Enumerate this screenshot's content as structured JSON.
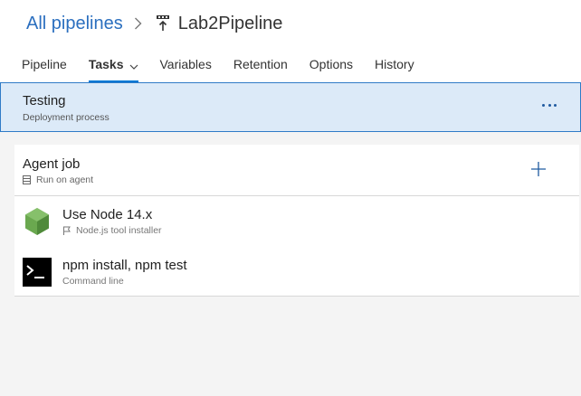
{
  "breadcrumb": {
    "root": "All pipelines",
    "separator_icon": "chevron-right-icon",
    "pipeline_icon": "release-pipeline-icon",
    "title": "Lab2Pipeline"
  },
  "tabs": [
    {
      "label": "Pipeline",
      "active": false
    },
    {
      "label": "Tasks",
      "active": true,
      "has_dropdown": true
    },
    {
      "label": "Variables",
      "active": false
    },
    {
      "label": "Retention",
      "active": false
    },
    {
      "label": "Options",
      "active": false
    },
    {
      "label": "History",
      "active": false
    }
  ],
  "stage": {
    "name": "Testing",
    "subtitle": "Deployment process",
    "more_icon": "ellipsis-icon"
  },
  "agent_job": {
    "title": "Agent job",
    "subtitle": "Run on agent",
    "subtitle_icon": "server-icon",
    "add_icon": "plus-icon"
  },
  "tasks": [
    {
      "name": "Use Node 14.x",
      "subtitle": "Node.js tool installer",
      "icon": "nodejs-icon",
      "subtitle_icon": "flag-icon"
    },
    {
      "name": "npm install, npm test",
      "subtitle": "Command line",
      "icon": "command-line-icon"
    }
  ],
  "colors": {
    "accent": "#0078d4",
    "link": "#2b6fbf",
    "stage_bg": "#dceaf8",
    "stage_border": "#2f7bc7",
    "node_green": "#6aa84f"
  }
}
